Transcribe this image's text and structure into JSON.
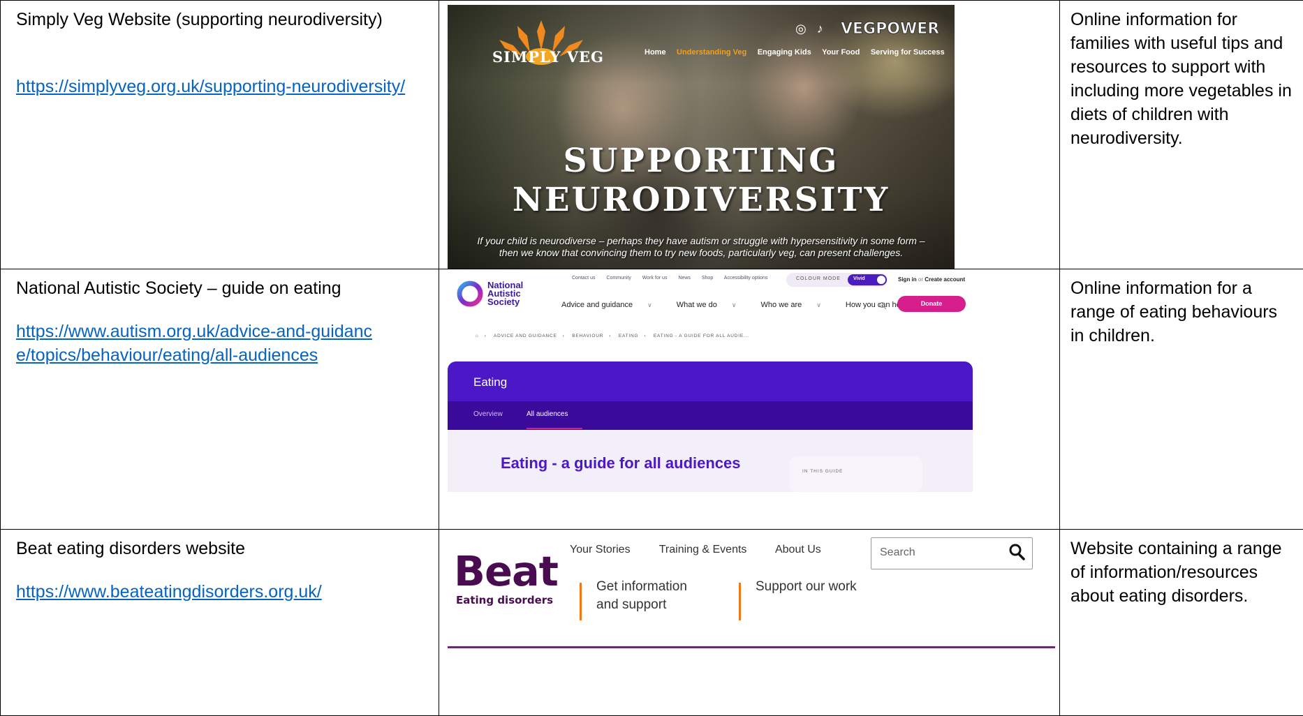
{
  "rows": [
    {
      "title": "Simply Veg Website (supporting neurodiversity)",
      "url": "https://simplyveg.org.uk/supporting-neurodiversity/",
      "description": "Online information for families with useful tips and resources to support with including more vegetables in diets of children with neurodiversity."
    },
    {
      "title": "National Autistic Society – guide on eating",
      "url": "https://www.autism.org.uk/advice-and-guidance/topics/behaviour/eating/all-audiences",
      "description": "Online information for a range of eating behaviours in children."
    },
    {
      "title": "Beat eating disorders website",
      "url": "https://www.beateatingdisorders.org.uk/",
      "description": "Website containing a range of information/resources about eating disorders."
    }
  ],
  "simplyveg": {
    "logo_text": "SIMPLY VEG",
    "vegpower": "VEGPOWER",
    "nav": [
      "Home",
      "Understanding Veg",
      "Engaging Kids",
      "Your Food",
      "Serving for Success"
    ],
    "heading_line1": "SUPPORTING",
    "heading_line2": "NEURODIVERSITY",
    "subtitle": "If your child is neurodiverse – perhaps they have autism or struggle with hypersensitivity in some form – then we know that convincing them to try new foods, particularly veg, can present challenges.",
    "social_icons": [
      "instagram-icon",
      "tiktok-icon"
    ]
  },
  "nas": {
    "logo_lines": [
      "National",
      "Autistic",
      "Society"
    ],
    "util_links": [
      "Contact us",
      "Community",
      "Work for us",
      "News",
      "Shop",
      "Accessibility options"
    ],
    "colour_mode_label": "COLOUR MODE",
    "colour_mode_value": "Vivid",
    "sign_in": "Sign in",
    "or": "or",
    "create_account": "Create account",
    "nav": [
      "Advice and guidance",
      "What we do",
      "Who we are",
      "How you can help"
    ],
    "donate": "Donate",
    "breadcrumb": [
      "ADVICE AND GUIDANCE",
      "BEHAVIOUR",
      "EATING",
      "EATING - A GUIDE FOR ALL AUDIE..."
    ],
    "band_title": "Eating",
    "tabs": [
      "Overview",
      "All audiences"
    ],
    "page_heading": "Eating - a guide for all audiences",
    "guide_label": "IN THIS GUIDE",
    "colors": {
      "purple": "#4b17c7",
      "dark_purple": "#3a0a9a",
      "pink": "#d61f8c"
    }
  },
  "beat": {
    "logo": "Beat",
    "logo_sub": "Eating disorders",
    "top_nav": [
      "Your Stories",
      "Training & Events",
      "About Us"
    ],
    "search_placeholder": "Search",
    "link1_line1": "Get information",
    "link1_line2": "and support",
    "link2": "Support our work",
    "colors": {
      "brand": "#4a0c50",
      "accent": "#f07818"
    }
  }
}
